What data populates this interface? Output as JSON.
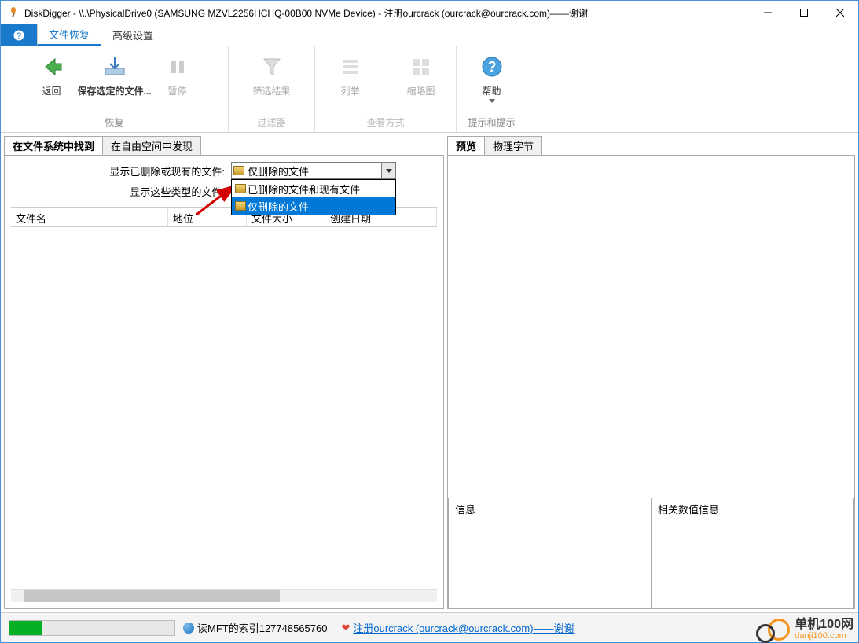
{
  "window": {
    "title": "DiskDigger - \\\\.\\PhysicalDrive0 (SAMSUNG MZVL2256HCHQ-00B00 NVMe Device) - 注册ourcrack (ourcrack@ourcrack.com)——谢谢"
  },
  "menu": {
    "file_recover": "文件恢复",
    "advanced_settings": "高级设置"
  },
  "ribbon": {
    "back": "返回",
    "save_selected": "保存选定的文件...",
    "pause": "暂停",
    "filter_results": "筛选结果",
    "list": "列举",
    "thumbnails": "缩略图",
    "help": "帮助",
    "group_recover": "恢复",
    "group_filter": "过滤器",
    "group_view": "查看方式",
    "group_tips": "提示和提示"
  },
  "left": {
    "tab_found": "在文件系统中找到",
    "tab_free": "在自由空间中发现",
    "filter1_label": "显示已删除或现有的文件:",
    "filter2_label": "显示这些类型的文件:",
    "combo_selected": "仅删除的文件",
    "combo_option1": "已删除的文件和现有文件",
    "combo_option2": "仅删除的文件",
    "col_name": "文件名",
    "col_status": "地位",
    "col_size": "文件大小",
    "col_date": "创建日期"
  },
  "right": {
    "tab_preview": "预览",
    "tab_bytes": "物理字节",
    "info_label": "信息",
    "info_value_label": "相关数值信息"
  },
  "status": {
    "mft_text": "读MFT的索引127748565760",
    "reg_link": "注册ourcrack (ourcrack@ourcrack.com)——谢谢"
  },
  "watermark": {
    "site_name": "单机100网",
    "domain": "danji100.com"
  }
}
